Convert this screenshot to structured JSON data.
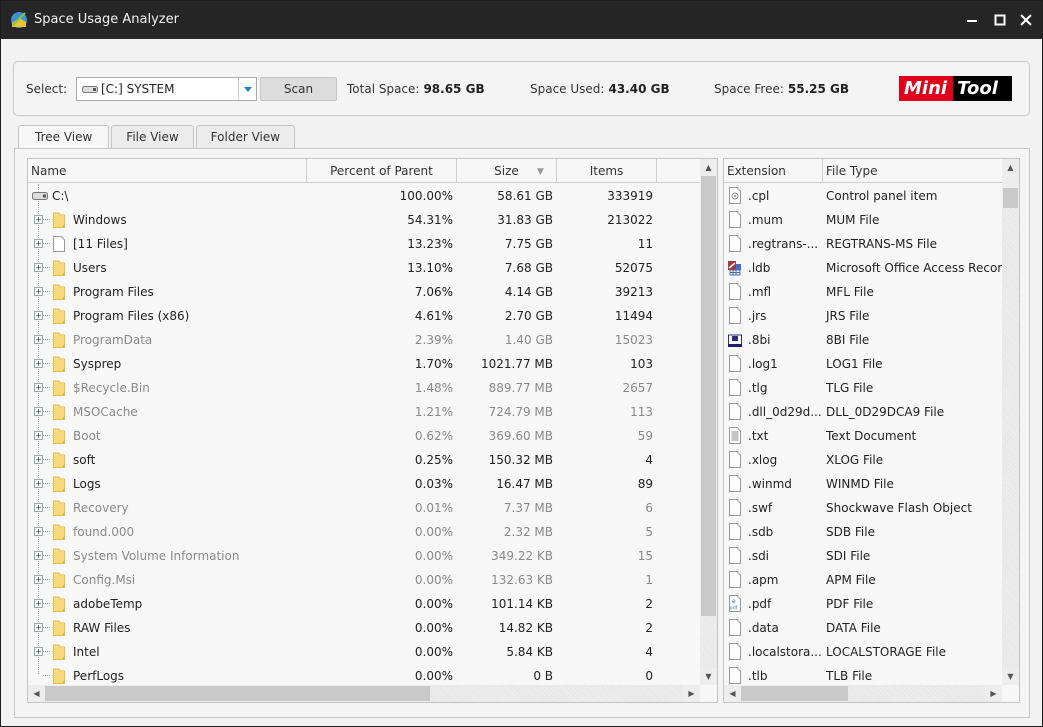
{
  "window": {
    "title": "Space Usage Analyzer",
    "controls": [
      "minimize",
      "maximize",
      "close"
    ]
  },
  "toolbar": {
    "select_label": "Select:",
    "drive_value": "[C:] SYSTEM",
    "scan_label": "Scan",
    "total_label": "Total Space:",
    "total_value": "98.65 GB",
    "used_label": "Space Used:",
    "used_value": "43.40 GB",
    "free_label": "Space Free:",
    "free_value": "55.25 GB",
    "logo_mini": "Mini",
    "logo_tool": "Tool",
    "logo_colors": {
      "mini_bg": "#e0001b",
      "tool_bg": "#000000"
    }
  },
  "tabs": [
    {
      "label": "Tree View",
      "active": true
    },
    {
      "label": "File View",
      "active": false
    },
    {
      "label": "Folder View",
      "active": false
    }
  ],
  "tree": {
    "columns": {
      "name": "Name",
      "percent": "Percent of Parent",
      "size": "Size",
      "items": "Items"
    },
    "sorted_by": "Size",
    "rows": [
      {
        "name": "C:\\",
        "type": "drive",
        "percent": "100.00%",
        "size": "58.61 GB",
        "items": "333919",
        "dim": false
      },
      {
        "name": "Windows",
        "type": "folder",
        "percent": "54.31%",
        "size": "31.83 GB",
        "items": "213022",
        "dim": false,
        "expandable": true
      },
      {
        "name": "[11 Files]",
        "type": "file",
        "percent": "13.23%",
        "size": "7.75 GB",
        "items": "11",
        "dim": false,
        "expandable": true
      },
      {
        "name": "Users",
        "type": "folder",
        "percent": "13.10%",
        "size": "7.68 GB",
        "items": "52075",
        "dim": false,
        "expandable": true
      },
      {
        "name": "Program Files",
        "type": "folder",
        "percent": "7.06%",
        "size": "4.14 GB",
        "items": "39213",
        "dim": false,
        "expandable": true
      },
      {
        "name": "Program Files (x86)",
        "type": "folder",
        "percent": "4.61%",
        "size": "2.70 GB",
        "items": "11494",
        "dim": false,
        "expandable": true
      },
      {
        "name": "ProgramData",
        "type": "folder",
        "percent": "2.39%",
        "size": "1.40 GB",
        "items": "15023",
        "dim": true,
        "expandable": true
      },
      {
        "name": "Sysprep",
        "type": "folder",
        "percent": "1.70%",
        "size": "1021.77 MB",
        "items": "103",
        "dim": false,
        "expandable": true
      },
      {
        "name": "$Recycle.Bin",
        "type": "folder",
        "percent": "1.48%",
        "size": "889.77 MB",
        "items": "2657",
        "dim": true,
        "expandable": true
      },
      {
        "name": "MSOCache",
        "type": "folder",
        "percent": "1.21%",
        "size": "724.79 MB",
        "items": "113",
        "dim": true,
        "expandable": true
      },
      {
        "name": "Boot",
        "type": "folder",
        "percent": "0.62%",
        "size": "369.60 MB",
        "items": "59",
        "dim": true,
        "expandable": true
      },
      {
        "name": "soft",
        "type": "folder",
        "percent": "0.25%",
        "size": "150.32 MB",
        "items": "4",
        "dim": false,
        "expandable": true
      },
      {
        "name": "Logs",
        "type": "folder",
        "percent": "0.03%",
        "size": "16.47 MB",
        "items": "89",
        "dim": false,
        "expandable": true
      },
      {
        "name": "Recovery",
        "type": "folder",
        "percent": "0.01%",
        "size": "7.37 MB",
        "items": "6",
        "dim": true,
        "expandable": true
      },
      {
        "name": "found.000",
        "type": "folder",
        "percent": "0.00%",
        "size": "2.32 MB",
        "items": "5",
        "dim": true,
        "expandable": true
      },
      {
        "name": "System Volume Information",
        "type": "folder",
        "percent": "0.00%",
        "size": "349.22 KB",
        "items": "15",
        "dim": true,
        "expandable": true
      },
      {
        "name": "Config.Msi",
        "type": "folder",
        "percent": "0.00%",
        "size": "132.63 KB",
        "items": "1",
        "dim": true,
        "expandable": true
      },
      {
        "name": "adobeTemp",
        "type": "folder",
        "percent": "0.00%",
        "size": "101.14 KB",
        "items": "2",
        "dim": false,
        "expandable": true
      },
      {
        "name": "RAW Files",
        "type": "folder",
        "percent": "0.00%",
        "size": "14.82 KB",
        "items": "2",
        "dim": false,
        "expandable": true
      },
      {
        "name": "Intel",
        "type": "folder",
        "percent": "0.00%",
        "size": "5.84 KB",
        "items": "4",
        "dim": false,
        "expandable": true
      },
      {
        "name": "PerfLogs",
        "type": "folder",
        "percent": "0.00%",
        "size": "0 B",
        "items": "0",
        "dim": false,
        "expandable": false
      }
    ]
  },
  "extensions": {
    "columns": {
      "extension": "Extension",
      "file_type": "File Type"
    },
    "rows": [
      {
        "ext": ".cpl",
        "type": "Control panel item",
        "icon": "control-panel-icon"
      },
      {
        "ext": ".mum",
        "type": "MUM File",
        "icon": "file-icon"
      },
      {
        "ext": ".regtrans-...",
        "type": "REGTRANS-MS File",
        "icon": "file-icon"
      },
      {
        "ext": ".ldb",
        "type": "Microsoft Office Access Record",
        "icon": "access-icon"
      },
      {
        "ext": ".mfl",
        "type": "MFL File",
        "icon": "file-icon"
      },
      {
        "ext": ".jrs",
        "type": "JRS File",
        "icon": "file-icon"
      },
      {
        "ext": ".8bi",
        "type": "8BI File",
        "icon": "plugin-icon"
      },
      {
        "ext": ".log1",
        "type": "LOG1 File",
        "icon": "file-icon"
      },
      {
        "ext": ".tlg",
        "type": "TLG File",
        "icon": "file-icon"
      },
      {
        "ext": ".dll_0d29d...",
        "type": "DLL_0D29DCA9 File",
        "icon": "file-icon"
      },
      {
        "ext": ".txt",
        "type": "Text Document",
        "icon": "text-document-icon"
      },
      {
        "ext": ".xlog",
        "type": "XLOG File",
        "icon": "file-icon"
      },
      {
        "ext": ".winmd",
        "type": "WINMD File",
        "icon": "file-icon"
      },
      {
        "ext": ".swf",
        "type": "Shockwave Flash Object",
        "icon": "file-icon"
      },
      {
        "ext": ".sdb",
        "type": "SDB File",
        "icon": "file-icon"
      },
      {
        "ext": ".sdi",
        "type": "SDI File",
        "icon": "file-icon"
      },
      {
        "ext": ".apm",
        "type": "APM File",
        "icon": "file-icon"
      },
      {
        "ext": ".pdf",
        "type": "PDF File",
        "icon": "pdf-icon"
      },
      {
        "ext": ".data",
        "type": "DATA File",
        "icon": "file-icon"
      },
      {
        "ext": ".localstora...",
        "type": "LOCALSTORAGE File",
        "icon": "file-icon"
      },
      {
        "ext": ".tlb",
        "type": "TLB File",
        "icon": "file-icon"
      }
    ]
  }
}
